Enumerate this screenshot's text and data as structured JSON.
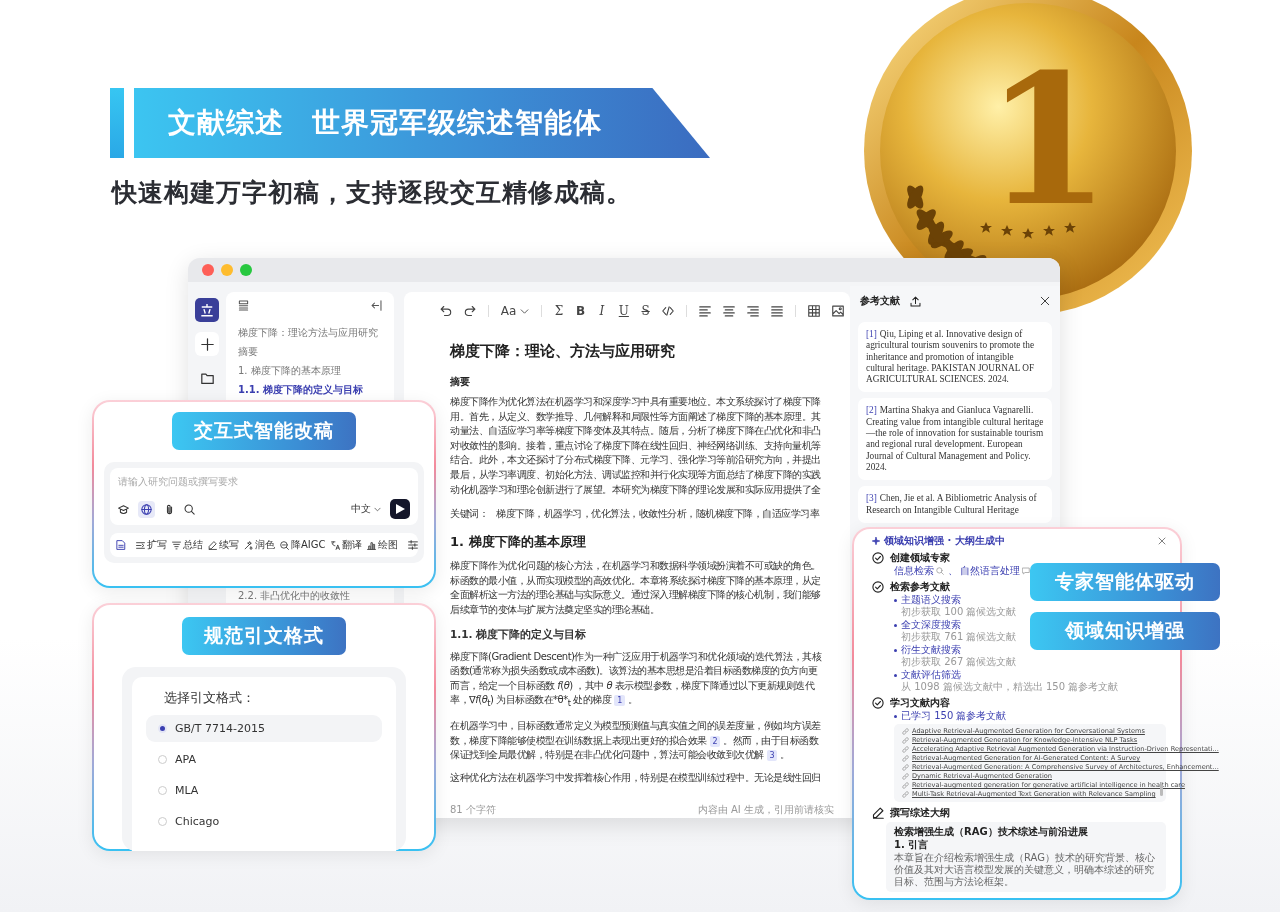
{
  "banner": {
    "label": "文献综述",
    "title": "世界冠军级综述智能体"
  },
  "subtitle": "快速构建万字初稿，支持逐段交互精修成稿。",
  "medal": {
    "numeral": "1"
  },
  "app": {
    "outline": {
      "items": [
        {
          "label": "梯度下降：理论方法与应用研究",
          "selected": false
        },
        {
          "label": "摘要",
          "selected": false
        },
        {
          "label": "1. 梯度下降的基本原理",
          "selected": false
        },
        {
          "label": "1.1. 梯度下降的定义与目标",
          "selected": true
        }
      ],
      "items_below": [
        {
          "label": "2.2. 非凸优化中的收敛性",
          "selected": false
        }
      ]
    },
    "toolbar": {
      "font_button": "Aa",
      "glyphs": [
        "Σ",
        "B",
        "I",
        "U",
        "S"
      ]
    },
    "document": {
      "title": "梯度下降：理论、方法与应用研究",
      "blocks": [
        {
          "kind": "label",
          "text": "摘要"
        },
        {
          "kind": "para",
          "lines": [
            {
              "text": "梯度下降作为优化算法在机器学习和深度学习中具有重要地位。本文系统探讨了梯度下降"
            },
            {
              "text": "用。首先，从定义、数学推导、几何解释和局限性等方面阐述了梯度下降的基本原理。其"
            },
            {
              "text": "动量法、自适应学习率等梯度下降变体及其特点。随后，分析了梯度下降在凸优化和非凸"
            },
            {
              "text": "对收敛性的影响。接着，重点讨论了梯度下降在线性回归、神经网络训练、支持向量机等"
            },
            {
              "text": "结合。此外，本文还探讨了分布式梯度下降、元学习、强化学习等前沿研究方向，并提出"
            },
            {
              "text": "最后，从学习率调度、初始化方法、调试监控和并行化实现等方面总结了梯度下降的实践"
            },
            {
              "text": "动化机器学习和理论创新进行了展望。本研究为梯度下降的理论发展和实际应用提供了全"
            }
          ]
        },
        {
          "kind": "keywords",
          "label": "关键词：",
          "text": "梯度下降，机器学习，优化算法，收敛性分析，随机梯度下降，自适应学习率"
        },
        {
          "kind": "heading",
          "text": "1. 梯度下降的基本原理"
        },
        {
          "kind": "para",
          "lines": [
            {
              "text": "梯度下降作为优化问题的核心方法，在机器学习和数据科学领域扮演着不可或缺的角色。"
            },
            {
              "text": "标函数的最小值，从而实现模型的高效优化。本章将系统探讨梯度下降的基本原理，从定"
            },
            {
              "text": "全面解析这一方法的理论基础与实际意义。通过深入理解梯度下降的核心机制，我们能够"
            },
            {
              "text": "后续章节的变体与扩展方法奠定坚实的理论基础。"
            }
          ]
        },
        {
          "kind": "subheading",
          "text": "1.1. 梯度下降的定义与目标"
        },
        {
          "kind": "para",
          "lines": [
            {
              "text": "梯度下降(Gradient Descent)作为一种广泛应用于机器学习和优化领域的迭代算法，其核"
            },
            {
              "text": "函数(通常称为损失函数或成本函数)。该算法的基本思想是沿着目标函数梯度的负方向更"
            },
            {
              "text": "而言，给定一个目标函数 *f*(*θ*) ，其中 *θ* 表示模型参数，梯度下降通过以下更新规则迭代"
            },
            {
              "text": "率，∇*f*(*θ*$_{t}$) 为目标函数在*θ*$_{t}$ 处的梯度",
              "cite": "1",
              "after": "。"
            }
          ]
        },
        {
          "kind": "para",
          "lines": [
            {
              "text": "在机器学习中，目标函数通常定义为模型预测值与真实值之间的误差度量，例如均方误差"
            },
            {
              "text": "数，梯度下降能够使模型在训练数据上表现出更好的拟合效果",
              "cite": "2",
              "after": "。然而，由于目标函数"
            },
            {
              "text": "保证找到全局最优解，特别是在非凸优化问题中，算法可能会收敛到次优解",
              "cite": "3",
              "after": "。"
            }
          ]
        },
        {
          "kind": "para",
          "lines": [
            {
              "text": "这种优化方法在机器学习中发挥着核心作用，特别是在模型训练过程中。无论是线性回归"
            }
          ]
        }
      ]
    },
    "footer": {
      "count": "81 个字符",
      "note": "内容由 AI 生成，引用前请核实"
    },
    "references": {
      "title": "参考文献",
      "items": [
        {
          "index": "[1]",
          "text": "Qiu, Liping et al. Innovative design of agricultural tourism souvenirs to promote the inheritance and promotion of intangible cultural heritage. PAKISTAN JOURNAL OF AGRICULTURAL SCIENCES. 2024."
        },
        {
          "index": "[2]",
          "text": "Martina Shakya and Gianluca Vagnarelli. Creating value from intangible cultural heritage—the role of innovation for sustainable tourism and regional rural development. European Journal of Cultural Management and Policy. 2024."
        },
        {
          "index": "[3]",
          "text": "Chen, Jie et al. A Bibliometric Analysis of Research on Intangible Cultural Heritage"
        }
      ]
    }
  },
  "chat_card": {
    "title": "交互式智能改稿",
    "placeholder": "请输入研究问题或撰写要求",
    "language": "中文",
    "tools": [
      {
        "kind": "expand",
        "label": "扩写"
      },
      {
        "kind": "summary",
        "label": "总结"
      },
      {
        "kind": "continue",
        "label": "续写"
      },
      {
        "kind": "polish",
        "label": "润色"
      },
      {
        "kind": "aigc",
        "label": "降AIGC"
      },
      {
        "kind": "translate",
        "label": "翻译"
      },
      {
        "kind": "chart",
        "label": "绘图"
      }
    ]
  },
  "citation_card": {
    "title": "规范引文格式",
    "prompt": "选择引文格式：",
    "options": [
      {
        "label": "GB/T 7714-2015",
        "selected": true
      },
      {
        "label": "APA",
        "selected": false
      },
      {
        "label": "MLA",
        "selected": false
      },
      {
        "label": "Chicago",
        "selected": false
      }
    ]
  },
  "agent_card": {
    "title": "领域知识增强 · 大纲生成中",
    "steps": [
      {
        "kind": "done",
        "title": "创建领域专家",
        "tags": [
          {
            "label": "信息检索",
            "sep": "、"
          },
          {
            "label": "自然语言处理"
          }
        ]
      },
      {
        "kind": "done",
        "title": "检索参考文献",
        "bullets": [
          {
            "label": "主题语义搜索",
            "detail": "初步获取 100 篇候选文献"
          },
          {
            "label": "全文深度搜索",
            "detail": "初步获取 761 篇候选文献"
          },
          {
            "label": "衍生文献搜索",
            "detail": "初步获取 267 篇候选文献"
          },
          {
            "label": "文献评估筛选",
            "detail": "从 1098 篇候选文献中，精选出 150 篇参考文献"
          }
        ]
      },
      {
        "kind": "done",
        "title": "学习文献内容",
        "bullets": [
          {
            "label": "已学习 150 篇参考文献"
          }
        ],
        "links": [
          "Adaptive Retrieval-Augmented Generation for Conversational Systems",
          "Retrieval-Augmented Generation for Knowledge-Intensive NLP Tasks",
          "Accelerating Adaptive Retrieval Augmented Generation via Instruction-Driven Representati...",
          "Retrieval-Augmented Generation for AI-Generated Content: A Survey",
          "Retrieval-Augmented Generation: A Comprehensive Survey of Architectures, Enhancement...",
          "Dynamic Retrieval-Augmented Generation",
          "Retrieval-augmented generation for generative artificial intelligence in health care",
          "Multi-Task Retrieval-Augmented Text Generation with Relevance Sampling"
        ]
      },
      {
        "kind": "writing",
        "title": "撰写综述大纲",
        "outline": {
          "title": "检索增强生成（RAG）技术综述与前沿进展",
          "section": "1. 引言",
          "text": "本章旨在介绍检索增强生成（RAG）技术的研究背景、核心价值及其对大语言模型发展的关键意义，明确本综述的研究目标、范围与方法论框架。"
        }
      }
    ]
  },
  "feature_pills": [
    "专家智能体驱动",
    "领域知识增强"
  ]
}
